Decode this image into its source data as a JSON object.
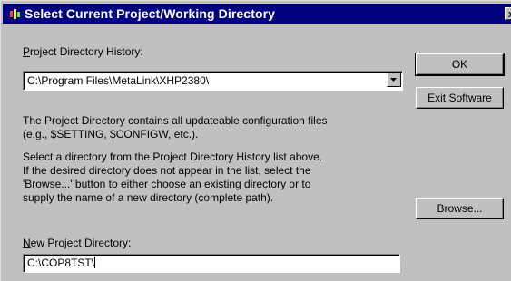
{
  "window": {
    "title": "Select Current Project/Working Directory",
    "close_label": "x"
  },
  "history": {
    "label_accel": "P",
    "label_rest": "roject Directory History:",
    "selected_value": "C:\\Program Files\\MetaLink\\XHP2380\\"
  },
  "description": {
    "paragraph1": [
      "The Project Directory contains all updateable configuration files",
      "(e.g., $SETTING, $CONFIGW, etc.)."
    ],
    "paragraph2": [
      "Select a directory from the Project Directory History list above.",
      "If the desired directory does not appear in the list, select the",
      "'Browse...' button to either choose an existing directory or to",
      "supply the name of a new directory (complete path)."
    ]
  },
  "new_directory": {
    "label_accel": "N",
    "label_rest": "ew Project Directory:",
    "value": "C:\\COP8TST\\"
  },
  "buttons": {
    "ok": "OK",
    "exit": "Exit Software",
    "browse": "Browse..."
  },
  "icons": {
    "app": "app-icon",
    "close": "close-icon",
    "dropdown": "chevron-down-icon"
  }
}
